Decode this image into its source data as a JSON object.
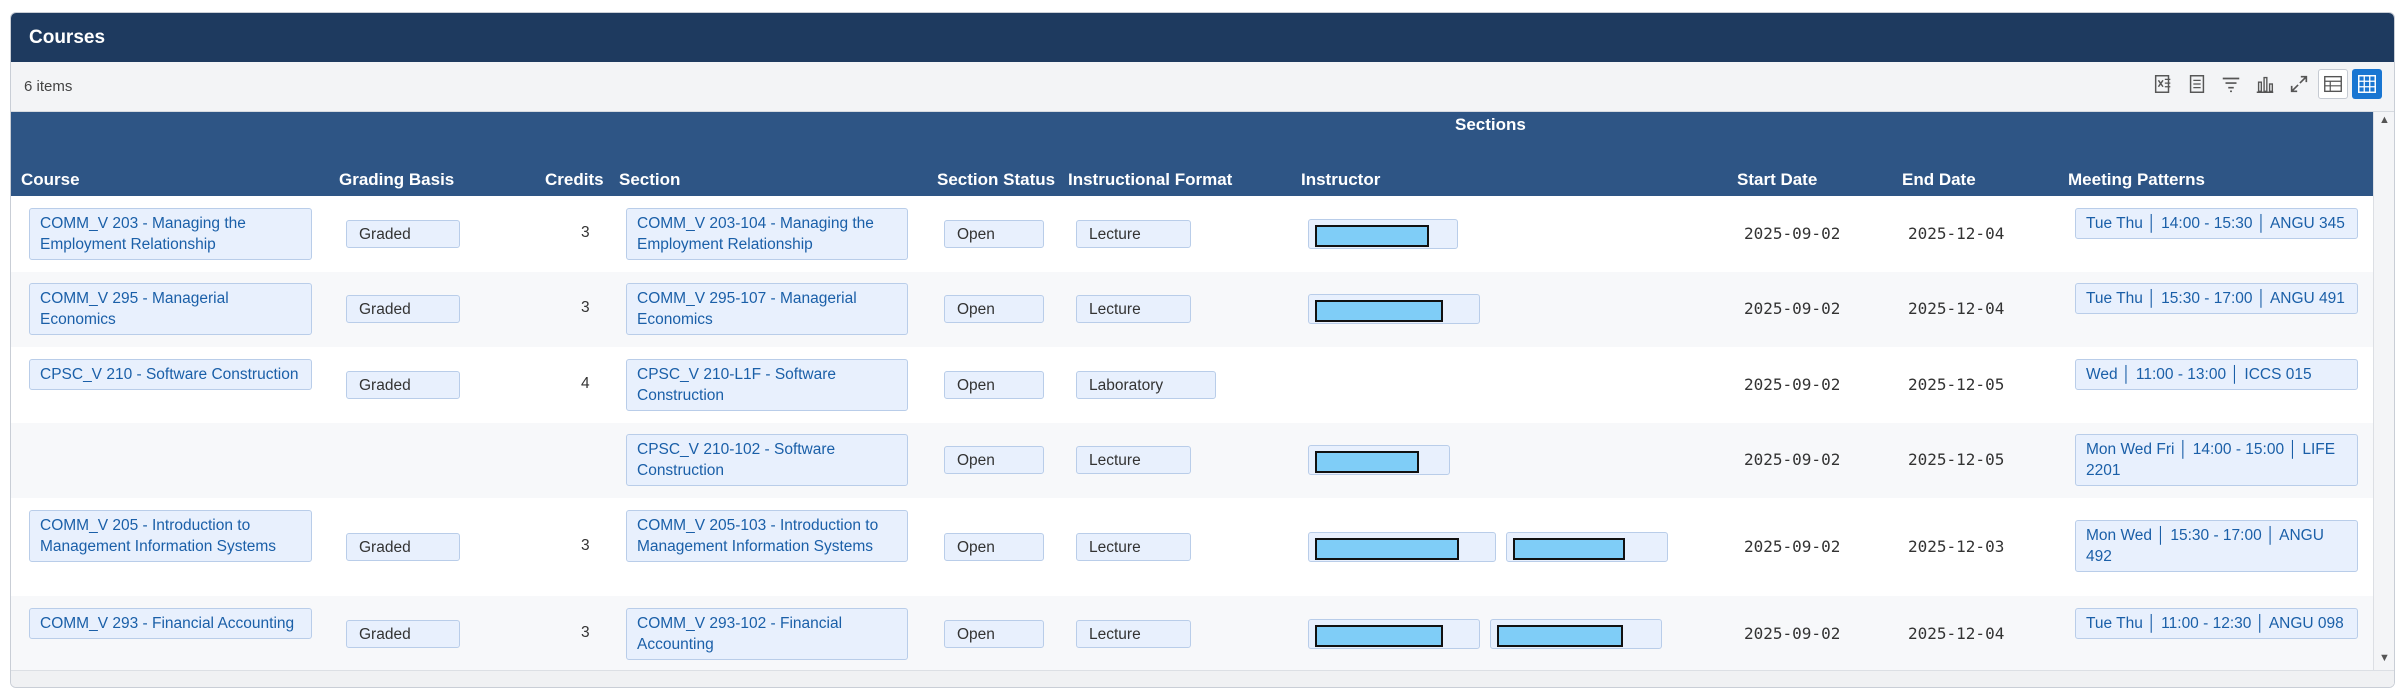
{
  "panel": {
    "title": "Courses"
  },
  "toolbar": {
    "items_count": "6 items",
    "tools": [
      {
        "name": "export-excel-icon"
      },
      {
        "name": "print-icon"
      },
      {
        "name": "filter-icon"
      },
      {
        "name": "chart-icon"
      },
      {
        "name": "fullscreen-icon"
      },
      {
        "name": "table-view-icon"
      },
      {
        "name": "grid-view-icon",
        "active": true
      }
    ]
  },
  "table": {
    "group_label": "Sections",
    "headers": {
      "course": "Course",
      "grading_basis": "Grading Basis",
      "credits": "Credits",
      "section": "Section",
      "section_status": "Section Status",
      "instructional_format": "Instructional Format",
      "instructor": "Instructor",
      "start_date": "Start Date",
      "end_date": "End Date",
      "meeting_patterns": "Meeting Patterns"
    },
    "rows": [
      {
        "course": "COMM_V 203 - Managing the Employment Relationship",
        "grading_basis": "Graded",
        "credits": "3",
        "section": "COMM_V 203-104 - Managing the Employment Relationship",
        "status": "Open",
        "format": "Lecture",
        "start": "2025-09-02",
        "end": "2025-12-04",
        "meeting": "Tue Thu │ 14:00 - 15:30 │ ANGU 345"
      },
      {
        "course": "COMM_V 295 - Managerial Economics",
        "grading_basis": "Graded",
        "credits": "3",
        "section": "COMM_V 295-107 - Managerial Economics",
        "status": "Open",
        "format": "Lecture",
        "start": "2025-09-02",
        "end": "2025-12-04",
        "meeting": "Tue Thu │ 15:30 - 17:00 │ ANGU 491"
      },
      {
        "course": "CPSC_V 210 - Software Construction",
        "grading_basis": "Graded",
        "credits": "4",
        "section": "CPSC_V 210-L1F - Software Construction",
        "status": "Open",
        "format": "Laboratory",
        "start": "2025-09-02",
        "end": "2025-12-05",
        "meeting": "Wed │ 11:00 - 13:00 │ ICCS 015"
      },
      {
        "course": "",
        "grading_basis": "",
        "credits": "",
        "section": "CPSC_V 210-102 - Software Construction",
        "status": "Open",
        "format": "Lecture",
        "start": "2025-09-02",
        "end": "2025-12-05",
        "meeting": "Mon Wed Fri │ 14:00 - 15:00 │ LIFE 2201"
      },
      {
        "course": "COMM_V 205 - Introduction to Management Information Systems",
        "grading_basis": "Graded",
        "credits": "3",
        "section": "COMM_V 205-103 - Introduction to Management Information Systems",
        "status": "Open",
        "format": "Lecture",
        "start": "2025-09-02",
        "end": "2025-12-03",
        "meeting": "Mon Wed │ 15:30 - 17:00 │ ANGU 492"
      },
      {
        "course": "COMM_V 293 - Financial Accounting",
        "grading_basis": "Graded",
        "credits": "3",
        "section": "COMM_V 293-102 - Financial Accounting",
        "status": "Open",
        "format": "Lecture",
        "start": "2025-09-02",
        "end": "2025-12-04",
        "meeting": "Tue Thu │ 11:00 - 12:30 │ ANGU 098"
      }
    ]
  }
}
